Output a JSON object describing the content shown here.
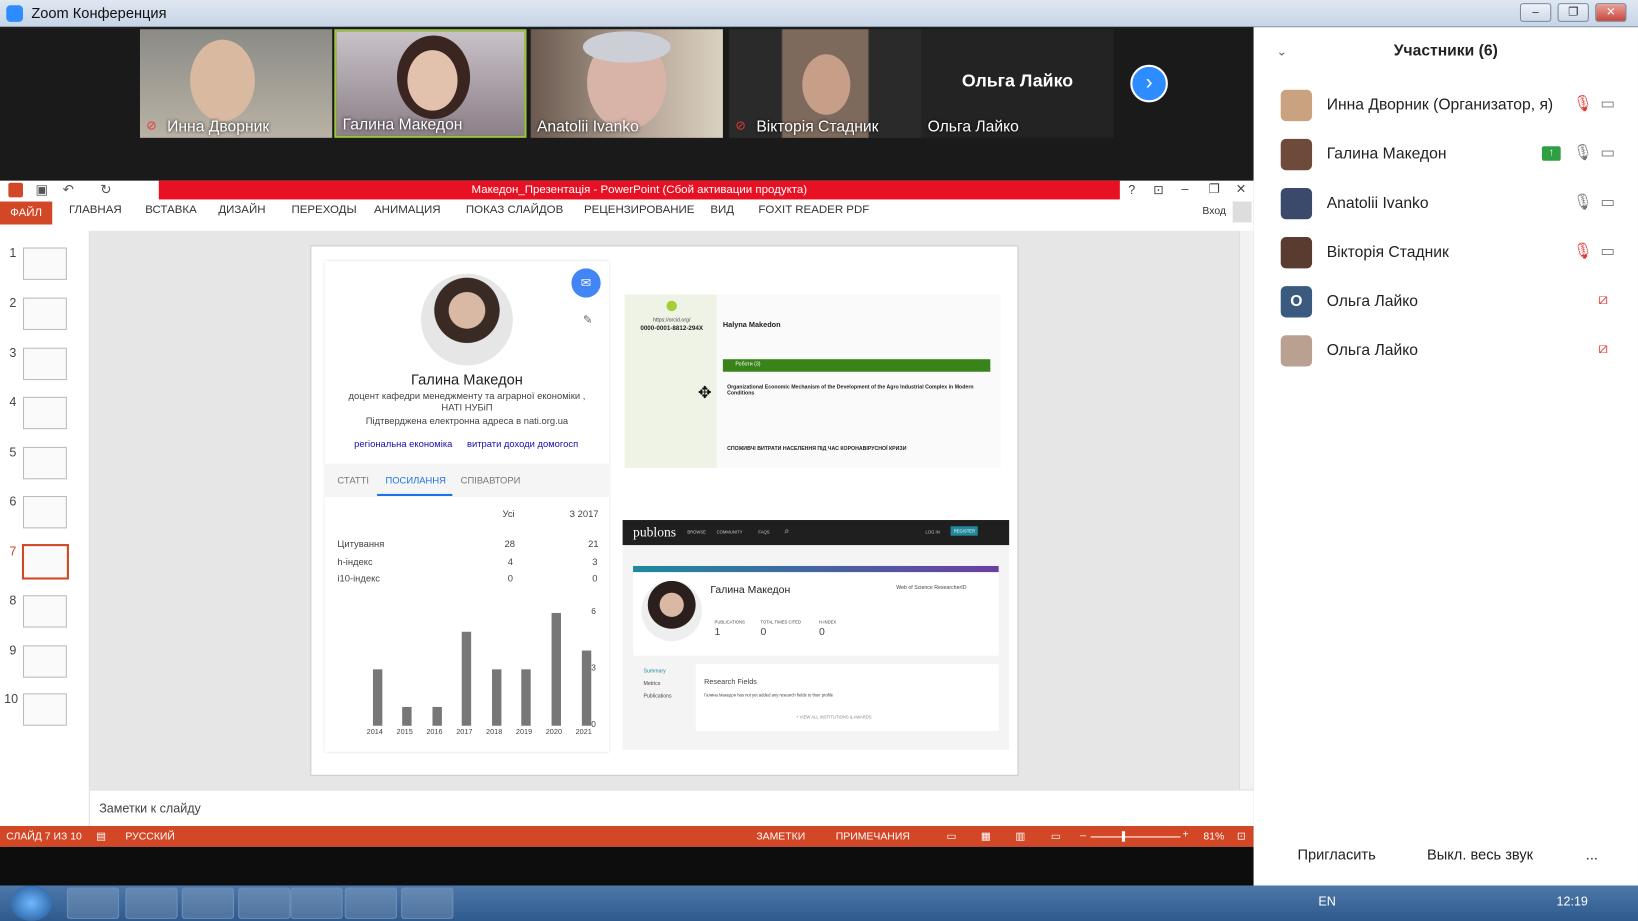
{
  "window": {
    "title": "Zoom Конференция"
  },
  "videos": [
    {
      "name": "Инна Дворник",
      "muted": true
    },
    {
      "name": "Галина Македон",
      "muted": false
    },
    {
      "name": "Anatolii Ivanko",
      "muted": false
    },
    {
      "name": "Вікторія Стадник",
      "muted": true
    },
    {
      "name": "Ольга Лайко",
      "muted": false
    }
  ],
  "participants": {
    "title": "Участники (6)",
    "items": [
      {
        "name": "Инна Дворник (Организатор, я)",
        "initial": "",
        "color": "#c9a37f"
      },
      {
        "name": "Галина Македон",
        "initial": "",
        "color": "#6d4a3a"
      },
      {
        "name": "Anatolii Ivanko",
        "initial": "",
        "color": "#3b4a6b"
      },
      {
        "name": "Вікторія Стадник",
        "initial": "",
        "color": "#5a3b30"
      },
      {
        "name": "Ольга Лайко",
        "initial": "О",
        "color": "#3a5a80"
      },
      {
        "name": "Ольга Лайко",
        "initial": "",
        "color": "#b9a090"
      }
    ],
    "invite": "Пригласить",
    "mute_all": "Выкл. весь звук",
    "more": "..."
  },
  "ppt": {
    "title": "Македон_Презентація - PowerPoint (Сбой активации продукта)",
    "file_tab": "ФАЙЛ",
    "tabs": [
      "ГЛАВНАЯ",
      "ВСТАВКА",
      "ДИЗАЙН",
      "ПЕРЕХОДЫ",
      "АНИМАЦИЯ",
      "ПОКАЗ СЛАЙДОВ",
      "РЕЦЕНЗИРОВАНИЕ",
      "ВИД",
      "FOXIT READER PDF"
    ],
    "signin": "Вход",
    "help": "?",
    "slide_numbers": [
      "1",
      "2",
      "3",
      "4",
      "5",
      "6",
      "7",
      "8",
      "9",
      "10"
    ],
    "notes_placeholder": "Заметки к слайду",
    "status": {
      "slide": "СЛАЙД 7 ИЗ 10",
      "lang": "РУССКИЙ",
      "notes": "ЗАМЕТКИ",
      "comments": "ПРИМЕЧАНИЯ",
      "zoom": "81%"
    }
  },
  "scholar": {
    "name": "Галина Македон",
    "affil1": "доцент кафедри менеджменту та аграрної економіки ,",
    "affil2": "НАТІ НУБіП",
    "email": "Підтверджена електронна адреса в nati.org.ua",
    "tag1": "регіональна економіка",
    "tag2": "витрати доходи домогосп",
    "tab_articles": "СТАТТІ",
    "tab_cites": "ПОСИЛАННЯ",
    "tab_coauthors": "СПІВАВТОРИ",
    "col_all": "Усі",
    "col_since": "З 2017",
    "rows": [
      {
        "label": "Цитування",
        "all": "28",
        "since": "21"
      },
      {
        "label": "h-індекс",
        "all": "4",
        "since": "3"
      },
      {
        "label": "i10-індекс",
        "all": "0",
        "since": "0"
      }
    ]
  },
  "chart_data": {
    "type": "bar",
    "categories": [
      "2014",
      "2015",
      "2016",
      "2017",
      "2018",
      "2019",
      "2020",
      "2021"
    ],
    "values": [
      3,
      1,
      1,
      5,
      3,
      3,
      6,
      4
    ],
    "ylim": [
      0,
      6
    ],
    "yticks": [
      "6",
      "3",
      "0"
    ]
  },
  "orcid": {
    "id": "0000-0001-8812-294X",
    "url": "https://orcid.org/",
    "name": "Halyna Makedon",
    "works": "Роботи (3)",
    "work1": "Organizational Economic Mechanism of the Development of the Agro Industrial Complex in Modern Conditions",
    "work2": "СПОЖИВЧІ ВИТРАТИ НАСЕЛЕННЯ ПІД ЧАС КОРОНАВІРУСНОЇ КРИЗИ"
  },
  "publons": {
    "logo": "publons",
    "nav": [
      "BROWSE",
      "COMMUNITY",
      "FAQS"
    ],
    "login": "LOG IN",
    "register": "REGISTER",
    "name": "Галина Македон",
    "rid_label": "Web of Science ResearcherID",
    "stats": [
      {
        "label": "PUBLICATIONS",
        "value": "1"
      },
      {
        "label": "TOTAL TIMES CITED",
        "value": "0"
      },
      {
        "label": "H-INDEX",
        "value": "0"
      }
    ],
    "menu": [
      "Summary",
      "Metrics",
      "Publications"
    ],
    "rf_title": "Research Fields",
    "rf_text": "Галина Македон has not yet added any research fields to their profile",
    "view_all": "+ VIEW ALL INSTITUTIONS & AWARDS"
  },
  "taskbar": {
    "lang": "EN",
    "time": "12:19"
  }
}
